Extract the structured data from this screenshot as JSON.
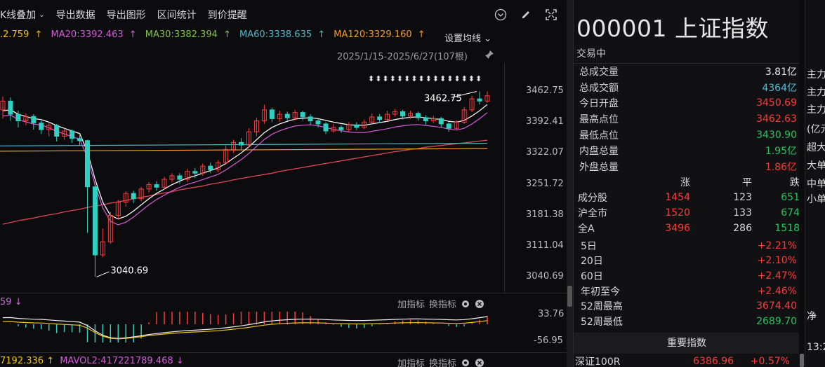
{
  "toolbar": {
    "kline_overlay": "K线叠加",
    "export_data": "导出数据",
    "export_chart": "导出图形",
    "range_stats": "区间统计",
    "price_alert": "到价提醒"
  },
  "ma": {
    "ma10": ".2.759",
    "ma20": "MA20:3392.463",
    "ma30": "MA30:3382.394",
    "ma60": "MA60:3338.635",
    "ma120": "MA120:3329.160",
    "arrow": "↑",
    "settings": "设置均线",
    "colors": {
      "ma10": "#f0c419",
      "ma20": "#d45ad8",
      "ma30": "#84c341",
      "ma60": "#4fb9c9",
      "ma120": "#f39a2a"
    }
  },
  "chart_data": {
    "type": "candlestick",
    "range_label": "2025/1/15-2025/6/27(107根)",
    "y_ticks": [
      "3462.75",
      "3392.41",
      "3322.07",
      "3251.72",
      "3181.38",
      "3111.04",
      "3040.69"
    ],
    "y_values": [
      3462.75,
      3392.41,
      3322.07,
      3251.72,
      3181.38,
      3111.04,
      3040.69
    ],
    "high_annotation": "3462.75",
    "low_annotation": "3040.69",
    "sub_max": "33.76",
    "sub_min": "-56.95",
    "candles": [
      [
        3420,
        3440,
        3400,
        3450
      ],
      [
        3440,
        3410,
        3395,
        3448
      ],
      [
        3410,
        3395,
        3380,
        3418
      ],
      [
        3395,
        3405,
        3385,
        3412
      ],
      [
        3405,
        3390,
        3375,
        3410
      ],
      [
        3390,
        3375,
        3365,
        3395
      ],
      [
        3375,
        3385,
        3360,
        3392
      ],
      [
        3385,
        3360,
        3348,
        3388
      ],
      [
        3360,
        3372,
        3352,
        3378
      ],
      [
        3372,
        3355,
        3345,
        3375
      ],
      [
        3355,
        3350,
        3340,
        3362
      ],
      [
        3350,
        3245,
        3140,
        3352
      ],
      [
        3245,
        3090,
        3040,
        3250
      ],
      [
        3090,
        3120,
        3085,
        3150
      ],
      [
        3120,
        3180,
        3115,
        3188
      ],
      [
        3180,
        3210,
        3170,
        3215
      ],
      [
        3210,
        3230,
        3200,
        3235
      ],
      [
        3230,
        3218,
        3208,
        3236
      ],
      [
        3218,
        3240,
        3212,
        3245
      ],
      [
        3240,
        3250,
        3232,
        3256
      ],
      [
        3250,
        3244,
        3236,
        3258
      ],
      [
        3244,
        3262,
        3238,
        3268
      ],
      [
        3262,
        3270,
        3255,
        3276
      ],
      [
        3270,
        3262,
        3252,
        3276
      ],
      [
        3262,
        3280,
        3256,
        3286
      ],
      [
        3280,
        3276,
        3265,
        3288
      ],
      [
        3276,
        3292,
        3270,
        3298
      ],
      [
        3292,
        3284,
        3276,
        3300
      ],
      [
        3284,
        3300,
        3278,
        3306
      ],
      [
        3300,
        3330,
        3295,
        3340
      ],
      [
        3330,
        3346,
        3322,
        3352
      ],
      [
        3346,
        3340,
        3330,
        3356
      ],
      [
        3340,
        3370,
        3335,
        3378
      ],
      [
        3370,
        3395,
        3360,
        3402
      ],
      [
        3395,
        3420,
        3388,
        3432
      ],
      [
        3420,
        3400,
        3392,
        3425
      ],
      [
        3400,
        3410,
        3393,
        3418
      ],
      [
        3410,
        3402,
        3394,
        3416
      ],
      [
        3402,
        3414,
        3396,
        3420
      ],
      [
        3414,
        3404,
        3396,
        3418
      ],
      [
        3404,
        3395,
        3386,
        3410
      ],
      [
        3395,
        3388,
        3380,
        3400
      ],
      [
        3388,
        3372,
        3365,
        3392
      ],
      [
        3372,
        3380,
        3368,
        3388
      ],
      [
        3380,
        3375,
        3368,
        3384
      ],
      [
        3375,
        3386,
        3370,
        3392
      ],
      [
        3386,
        3380,
        3374,
        3392
      ],
      [
        3380,
        3392,
        3376,
        3398
      ],
      [
        3392,
        3404,
        3388,
        3412
      ],
      [
        3404,
        3398,
        3390,
        3410
      ],
      [
        3398,
        3410,
        3394,
        3418
      ],
      [
        3410,
        3416,
        3405,
        3422
      ],
      [
        3416,
        3406,
        3398,
        3420
      ],
      [
        3406,
        3412,
        3400,
        3418
      ],
      [
        3412,
        3402,
        3395,
        3416
      ],
      [
        3402,
        3395,
        3386,
        3408
      ],
      [
        3395,
        3400,
        3390,
        3406
      ],
      [
        3400,
        3388,
        3380,
        3404
      ],
      [
        3388,
        3378,
        3370,
        3392
      ],
      [
        3378,
        3392,
        3374,
        3396
      ],
      [
        3392,
        3420,
        3388,
        3426
      ],
      [
        3420,
        3445,
        3415,
        3452
      ],
      [
        3445,
        3440,
        3432,
        3462
      ],
      [
        3440,
        3452,
        3436,
        3462
      ]
    ],
    "ma_short": [
      3418,
      3420,
      3410,
      3405,
      3400,
      3398,
      3392,
      3384,
      3378,
      3372,
      3366,
      3325,
      3262,
      3210,
      3180,
      3172,
      3178,
      3190,
      3204,
      3218,
      3230,
      3240,
      3250,
      3258,
      3265,
      3270,
      3276,
      3282,
      3288,
      3298,
      3310,
      3322,
      3336,
      3352,
      3368,
      3380,
      3388,
      3394,
      3399,
      3401,
      3402,
      3400,
      3396,
      3392,
      3389,
      3386,
      3385,
      3385,
      3388,
      3391,
      3394,
      3398,
      3401,
      3403,
      3404,
      3402,
      3400,
      3398,
      3394,
      3392,
      3396,
      3406,
      3418,
      3432
    ],
    "ma120_line": [
      3160,
      3164,
      3168,
      3171,
      3174,
      3178,
      3181,
      3184,
      3188,
      3191,
      3194,
      3198,
      3201,
      3204,
      3208,
      3211,
      3214,
      3218,
      3221,
      3224,
      3228,
      3231,
      3234,
      3238,
      3241,
      3244,
      3247,
      3251,
      3254,
      3257,
      3261,
      3264,
      3267,
      3270,
      3273,
      3276,
      3280,
      3283,
      3286,
      3289,
      3292,
      3295,
      3298,
      3301,
      3304,
      3307,
      3310,
      3313,
      3316,
      3319,
      3322,
      3325,
      3327,
      3330,
      3332,
      3335,
      3337,
      3339,
      3341,
      3343,
      3345,
      3347,
      3349,
      3351
    ]
  },
  "sub": {
    "hdr": "59",
    "hdr_arrow": "↓",
    "add_indicator": "加指标",
    "switch_indicator": "换指标"
  },
  "vol": {
    "text1": "7192.336",
    "text1_arrow": "↑",
    "text2": "MAVOL2:417221789.468",
    "text2_arrow": "↓",
    "add_indicator": "加指标",
    "switch_indicator": "换指标"
  },
  "stock": {
    "code_name": "000001 上证指数",
    "status": "交易中"
  },
  "stats": [
    {
      "label": "总成交量",
      "value": "3.81亿",
      "color": "#e6e6e6"
    },
    {
      "label": "总成交额",
      "value": "4364亿",
      "color": "#4fb9d6"
    },
    {
      "label": "今日开盘",
      "value": "3450.69",
      "color": "#ff3a3a"
    },
    {
      "label": "最高点位",
      "value": "3462.63",
      "color": "#ff3a3a"
    },
    {
      "label": "最低点位",
      "value": "3430.90",
      "color": "#22c55e"
    },
    {
      "label": "内盘总量",
      "value": "1.95亿",
      "color": "#22c55e"
    },
    {
      "label": "外盘总量",
      "value": "1.86亿",
      "color": "#ff3a3a"
    }
  ],
  "breadth": {
    "headers": [
      "涨",
      "平",
      "跌"
    ],
    "rows": [
      {
        "name": "成分股",
        "up": "1454",
        "flat": "123",
        "down": "651"
      },
      {
        "name": "沪全市",
        "up": "1520",
        "flat": "133",
        "down": "674"
      },
      {
        "name": "全A",
        "up": "3496",
        "flat": "286",
        "down": "1518"
      }
    ]
  },
  "perf": [
    {
      "label": "5日",
      "value": "+2.21%",
      "color": "#ff3a3a"
    },
    {
      "label": "20日",
      "value": "+2.10%",
      "color": "#ff3a3a"
    },
    {
      "label": "60日",
      "value": "+2.47%",
      "color": "#ff3a3a"
    },
    {
      "label": "年初至今",
      "value": "+2.46%",
      "color": "#ff3a3a"
    },
    {
      "label": "52周最高",
      "value": "3674.40",
      "color": "#ff3a3a"
    },
    {
      "label": "52周最低",
      "value": "2689.70",
      "color": "#22c55e"
    }
  ],
  "important": {
    "title": "重要指数",
    "row_name": "深证100R",
    "row_value": "6386.96",
    "row_pct": "+0.57%"
  },
  "far_right": [
    "主力",
    "主力",
    "主力",
    "(亿元",
    "超大",
    "大单",
    "中单",
    "小单",
    "净",
    "13:2"
  ]
}
